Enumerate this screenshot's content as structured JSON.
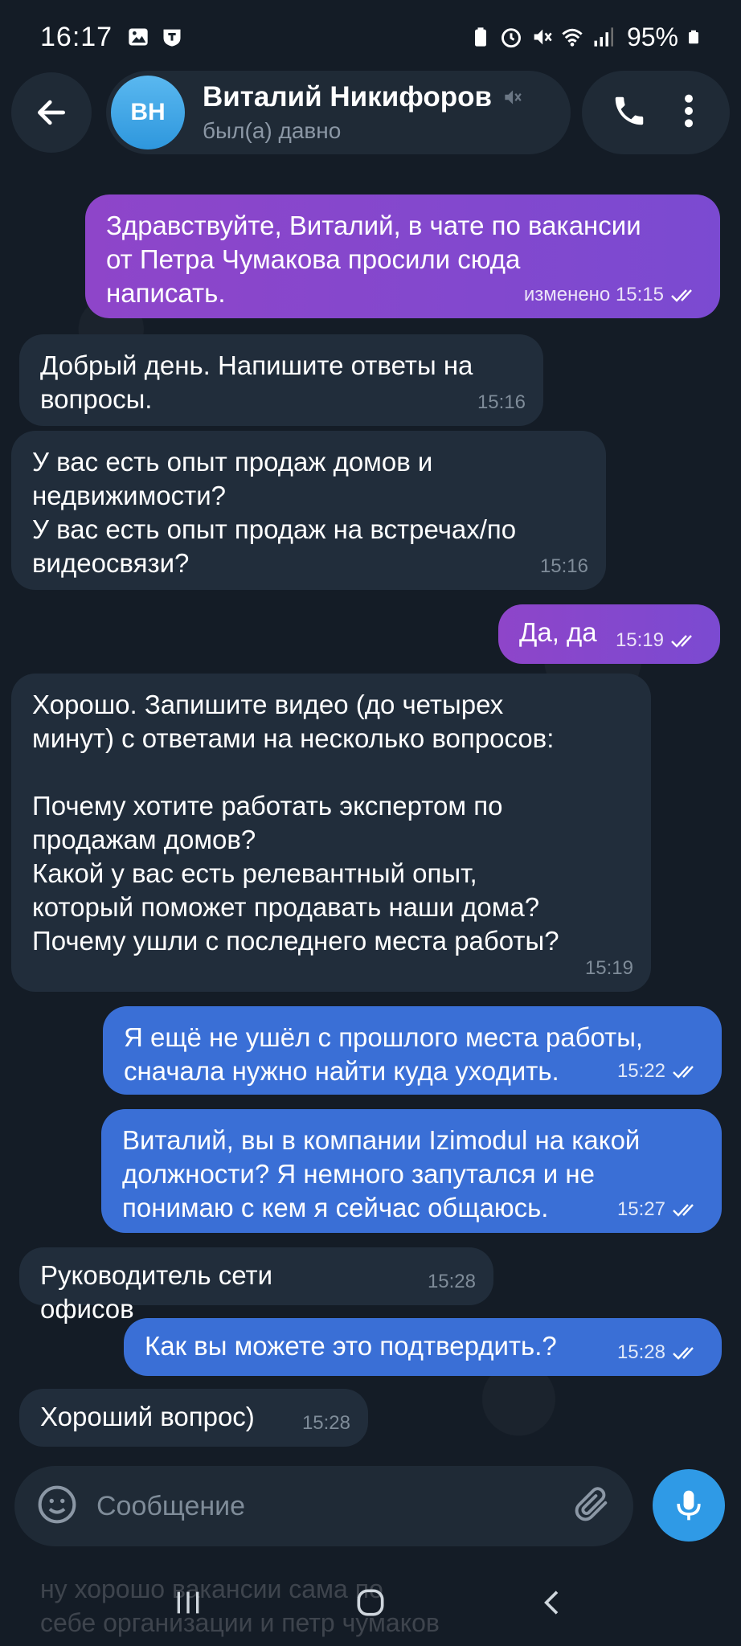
{
  "status_bar": {
    "time": "16:17",
    "battery": "95%"
  },
  "header": {
    "avatar_initials": "ВН",
    "contact_name": "Виталий Никифоров",
    "contact_status": "был(а) давно",
    "muted_icon": "muted-icon",
    "call_icon": "phone-icon",
    "menu_icon": "more-vertical-icon"
  },
  "messages": [
    {
      "direction": "out",
      "text": "Здравствуйте, Виталий,  в чате по вакансии\nот Петра Чумакова просили сюда\nнаписать.",
      "meta": "изменено 15:15",
      "read": true
    },
    {
      "direction": "in",
      "text": "Добрый день. Напишите ответы на\nвопросы.",
      "meta": "15:16"
    },
    {
      "direction": "in",
      "text": "У вас есть опыт продаж домов и\nнедвижимости?\nУ вас есть опыт продаж на встречах/по\nвидеосвязи?",
      "meta": "15:16"
    },
    {
      "direction": "out",
      "text": "Да, да",
      "meta": "15:19",
      "read": true
    },
    {
      "direction": "in",
      "text": "Хорошо. Запишите видео (до четырех\nминут) с ответами на несколько вопросов:\n\nПочему хотите работать экспертом по\nпродажам домов?\nКакой у вас есть релевантный опыт,\nкоторый поможет продавать наши дома?\nПочему ушли с последнего места работы?",
      "meta": "15:19"
    },
    {
      "direction": "out",
      "text": "Я ещё не ушёл с прошлого места работы,\nсначала нужно найти куда уходить.",
      "meta": "15:22",
      "read": true
    },
    {
      "direction": "out",
      "text": "Виталий, вы в компании Izimodul на какой\nдолжности? Я немного запутался и не\nпонимаю с кем я сейчас общаюсь.",
      "meta": "15:27",
      "read": true
    },
    {
      "direction": "in",
      "text": "Руководитель сети офисов",
      "meta": "15:28"
    },
    {
      "direction": "out",
      "text": "Как вы можете это подтвердить.?",
      "meta": "15:28",
      "read": true
    },
    {
      "direction": "in",
      "text": "Хороший вопрос)",
      "meta": "15:28"
    }
  ],
  "composer": {
    "placeholder": "Сообщение",
    "emoji_icon": "emoji-icon",
    "attach_icon": "paperclip-icon",
    "mic_icon": "microphone-icon"
  },
  "preview": {
    "text": "ну хорошо вакансии сама по\nсебе организации и петр чумаков"
  },
  "colors": {
    "background": "#141c26",
    "incoming_bubble": "#212d3b",
    "outgoing_purple": "#8e45c9",
    "outgoing_blue": "#3a6fd6",
    "accent": "#2f9ae6"
  }
}
